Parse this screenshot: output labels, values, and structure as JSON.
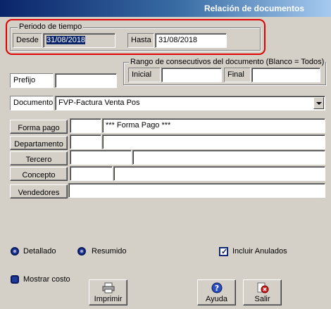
{
  "window": {
    "title": "Relación de documentos"
  },
  "periodo": {
    "group_label": "Periodo de tiempo",
    "desde_label": "Desde",
    "desde_value": "31/08/2018",
    "hasta_label": "Hasta",
    "hasta_value": "31/08/2018"
  },
  "rango": {
    "group_label": "Rango de consecutivos del documento (Blanco = Todos)",
    "inicial_label": "Inicial",
    "inicial_value": "",
    "final_label": "Final",
    "final_value": ""
  },
  "prefijo": {
    "label": "Prefijo",
    "value": ""
  },
  "documento": {
    "label": "Documento",
    "value": "FVP-Factura Venta Pos"
  },
  "filters": {
    "forma_pago": {
      "button": "Forma pago",
      "code": "",
      "desc": "*** Forma Pago ***"
    },
    "departamento": {
      "button": "Departamento",
      "code": "",
      "desc": ""
    },
    "tercero": {
      "button": "Tercero",
      "code": "",
      "desc": ""
    },
    "concepto": {
      "button": "Concepto",
      "code": "",
      "desc": ""
    },
    "vendedores": {
      "button": "Vendedores",
      "value": ""
    }
  },
  "options": {
    "detallado": "Detallado",
    "resumido": "Resumido",
    "incluir_anulados": "Incluir Anulados",
    "incluir_anulados_checked": true,
    "mostrar_costo": "Mostrar costo"
  },
  "actions": {
    "imprimir": "Imprimir",
    "ayuda": "Ayuda",
    "salir": "Salir"
  }
}
